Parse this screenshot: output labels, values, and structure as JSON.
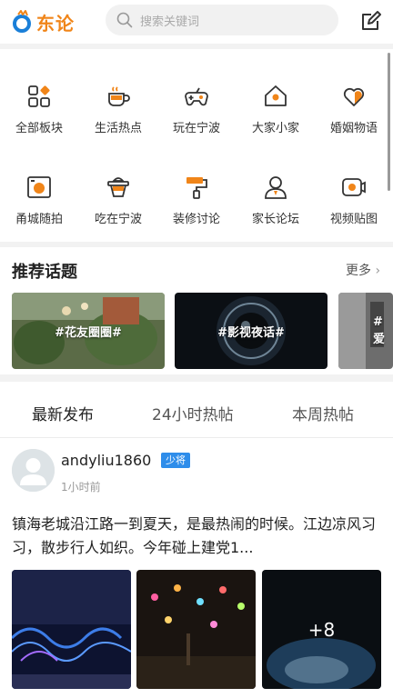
{
  "header": {
    "logo_text": "东论",
    "search_placeholder": "搜索关键词",
    "edit_icon": "edit-icon"
  },
  "categories": [
    {
      "label": "全部板块",
      "icon": "grid-icon"
    },
    {
      "label": "生活热点",
      "icon": "cup-icon"
    },
    {
      "label": "玩在宁波",
      "icon": "gamepad-icon"
    },
    {
      "label": "大家小家",
      "icon": "home-icon"
    },
    {
      "label": "婚姻物语",
      "icon": "heart-icon"
    },
    {
      "label": "甬城随拍",
      "icon": "camera-icon"
    },
    {
      "label": "吃在宁波",
      "icon": "food-icon"
    },
    {
      "label": "装修讨论",
      "icon": "paint-roller-icon"
    },
    {
      "label": "家长论坛",
      "icon": "parent-icon"
    },
    {
      "label": "视频贴图",
      "icon": "video-icon"
    }
  ],
  "topics": {
    "title": "推荐话题",
    "more": "更多",
    "cards": [
      {
        "label": "#花友圈圈#"
      },
      {
        "label": "#影视夜话#"
      },
      {
        "label": "#爱"
      }
    ]
  },
  "tabs": [
    {
      "label": "最新发布",
      "active": true
    },
    {
      "label": "24小时热帖",
      "active": false
    },
    {
      "label": "本周热帖",
      "active": false
    }
  ],
  "post": {
    "username": "andyliu1860",
    "badge": "少将",
    "time": "1小时前",
    "content": "镇海老城沿江路一到夏天，是最热闹的时候。江边凉风习习，散步行人如织。今年碰上建党1...",
    "more_images": "+8"
  },
  "colors": {
    "accent": "#f08519",
    "blue_badge": "#2e8dea"
  }
}
